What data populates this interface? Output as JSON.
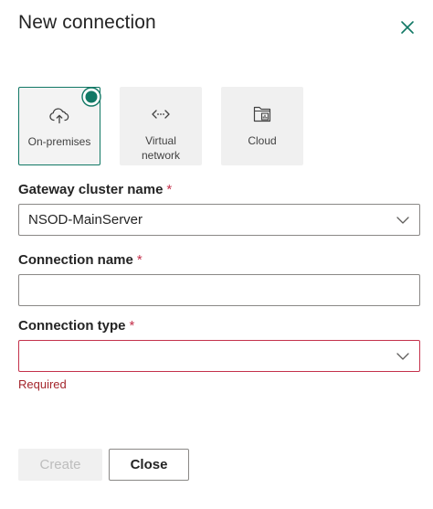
{
  "dialog": {
    "title": "New connection"
  },
  "tiles": [
    {
      "label": "On-premises",
      "icon": "cloud-upload-icon",
      "selected": true
    },
    {
      "label": "Virtual\nnetwork",
      "icon": "code-arrows-icon",
      "selected": false
    },
    {
      "label": "Cloud",
      "icon": "folder-chart-icon",
      "selected": false
    }
  ],
  "gateway": {
    "label": "Gateway cluster name",
    "required_mark": "*",
    "value": "NSOD-MainServer"
  },
  "connection_name": {
    "label": "Connection name",
    "required_mark": "*",
    "value": ""
  },
  "connection_type": {
    "label": "Connection type",
    "required_mark": "*",
    "value": "",
    "error": "Required"
  },
  "buttons": {
    "create": "Create",
    "close": "Close"
  },
  "colors": {
    "accent": "#117865",
    "error": "#a4262c",
    "required": "#c4314b"
  }
}
